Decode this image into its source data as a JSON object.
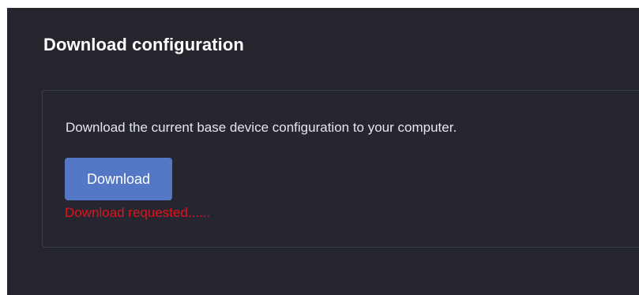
{
  "section": {
    "title": "Download configuration"
  },
  "card": {
    "description": "Download the current base device configuration to your computer.",
    "download_label": "Download",
    "status": "Download requested......"
  },
  "colors": {
    "background": "#24252d",
    "button": "#5478c6",
    "status": "#e0141e"
  }
}
